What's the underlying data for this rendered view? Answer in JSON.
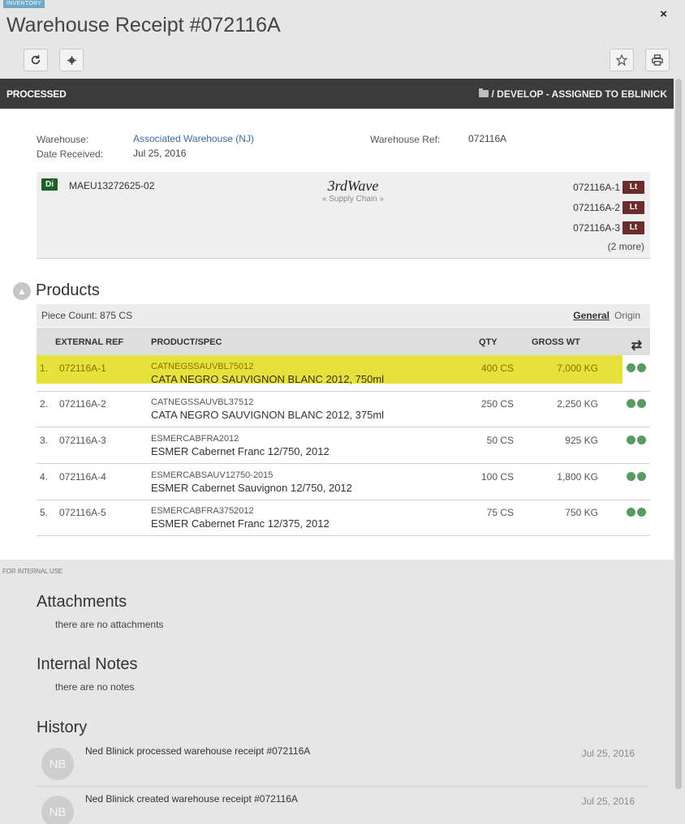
{
  "header": {
    "tag": "INVENTORY",
    "title": "Warehouse Receipt #072116A",
    "close_glyph": "×"
  },
  "toolbar": {
    "refresh_icon": "refresh-icon",
    "gear_icon": "gear-icon",
    "star_icon": "star-icon",
    "print_icon": "print-icon"
  },
  "status_bar": {
    "status": "PROCESSED",
    "assignment": "/ DEVELOP - ASSIGNED TO EBLINICK",
    "background": "#3b3b3b"
  },
  "info": {
    "warehouse_label": "Warehouse:",
    "warehouse_value": "Associated Warehouse (NJ)",
    "date_label": "Date Received:",
    "date_value": "Jul 25, 2016",
    "ref_label": "Warehouse Ref:",
    "ref_value": "072116A"
  },
  "shipment": {
    "badge": "Di",
    "container": "MAEU13272625-02",
    "logo_text": "3rdWave",
    "logo_sub": "« Supply Chain »",
    "lots": [
      {
        "id": "072116A-1",
        "badge": "Lt"
      },
      {
        "id": "072116A-2",
        "badge": "Lt"
      },
      {
        "id": "072116A-3",
        "badge": "Lt"
      }
    ],
    "more": "(2 more)"
  },
  "products": {
    "title": "Products",
    "piece_count": "Piece Count: 875 CS",
    "tabs": {
      "general": "General",
      "origin": "Origin"
    },
    "columns": {
      "external_ref": "EXTERNAL REF",
      "product_spec": "PRODUCT/SPEC",
      "qty": "QTY",
      "gross_wt": "GROSS WT"
    },
    "rows": [
      {
        "num": "1.",
        "ext": "072116A-1",
        "code": "CATNEGSSAUVBL75012",
        "name": "CATA NEGRO SAUVIGNON BLANC 2012, 750ml",
        "qty": "400 CS",
        "wt": "7,000 KG",
        "highlighted": true
      },
      {
        "num": "2.",
        "ext": "072116A-2",
        "code": "CATNEGSSAUVBL37512",
        "name": "CATA NEGRO SAUVIGNON BLANC 2012, 375ml",
        "qty": "250 CS",
        "wt": "2,250 KG",
        "highlighted": false
      },
      {
        "num": "3.",
        "ext": "072116A-3",
        "code": "ESMERCABFRA2012",
        "name": "ESMER Cabernet Franc 12/750, 2012",
        "qty": "50 CS",
        "wt": "925 KG",
        "highlighted": false
      },
      {
        "num": "4.",
        "ext": "072116A-4",
        "code": "ESMERCABSAUV12750-2015",
        "name": "ESMER Cabernet Sauvignon 12/750, 2012",
        "qty": "100 CS",
        "wt": "1,800 KG",
        "highlighted": false
      },
      {
        "num": "5.",
        "ext": "072116A-5",
        "code": "ESMERCABFRA3752012",
        "name": "ESMER Cabernet Franc 12/375, 2012",
        "qty": "75 CS",
        "wt": "750 KG",
        "highlighted": false
      }
    ]
  },
  "internal": {
    "label": "FOR INTERNAL USE",
    "attachments_title": "Attachments",
    "attachments_empty": "there are no attachments",
    "notes_title": "Internal Notes",
    "notes_empty": "there are no notes",
    "history_title": "History",
    "history": [
      {
        "initials": "NB",
        "text": "Ned Blinick processed warehouse receipt #072116A",
        "date": "Jul 25, 2016"
      },
      {
        "initials": "NB",
        "text": "Ned Blinick created warehouse receipt #072116A",
        "date": "Jul 25, 2016"
      }
    ]
  },
  "colors": {
    "highlight": "#e7e23b",
    "di_badge": "#1c5f27",
    "lot_badge": "#6b2c2c",
    "status_dot": "#5a9a63",
    "link": "#3c6e9f"
  }
}
